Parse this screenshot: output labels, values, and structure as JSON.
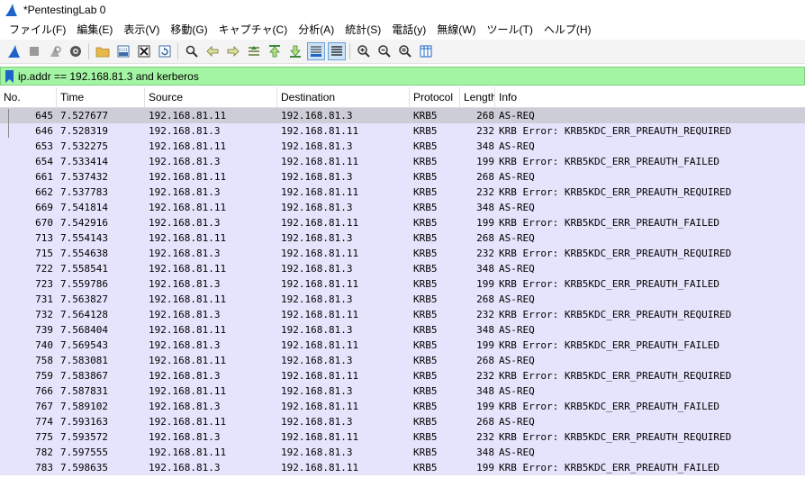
{
  "window": {
    "title": "*PentestingLab 0"
  },
  "menu": [
    "ファイル(F)",
    "編集(E)",
    "表示(V)",
    "移動(G)",
    "キャプチャ(C)",
    "分析(A)",
    "統計(S)",
    "電話(y)",
    "無線(W)",
    "ツール(T)",
    "ヘルプ(H)"
  ],
  "toolbar_icons": [
    "shark-fin-start-icon",
    "stop-icon",
    "restart-icon",
    "capture-options-icon",
    "|",
    "open-file-icon",
    "save-file-icon",
    "close-file-icon",
    "reload-file-icon",
    "|",
    "find-packet-icon",
    "go-back-icon",
    "go-forward-icon",
    "go-to-packet-icon",
    "go-first-icon",
    "go-last-icon",
    "autoscroll-icon",
    "colorize-icon",
    "|",
    "zoom-in-icon",
    "zoom-out-icon",
    "zoom-normal-icon",
    "resize-columns-icon"
  ],
  "filter": {
    "value": "ip.addr == 192.168.81.3 and kerberos"
  },
  "columns": [
    "No.",
    "Time",
    "Source",
    "Destination",
    "Protocol",
    "Length",
    "Info"
  ],
  "rows": [
    {
      "no": "645",
      "time": "7.527677",
      "src": "192.168.81.11",
      "dst": "192.168.81.3",
      "proto": "KRB5",
      "len": "268",
      "info": "AS-REQ"
    },
    {
      "no": "646",
      "time": "7.528319",
      "src": "192.168.81.3",
      "dst": "192.168.81.11",
      "proto": "KRB5",
      "len": "232",
      "info": "KRB Error: KRB5KDC_ERR_PREAUTH_REQUIRED"
    },
    {
      "no": "653",
      "time": "7.532275",
      "src": "192.168.81.11",
      "dst": "192.168.81.3",
      "proto": "KRB5",
      "len": "348",
      "info": "AS-REQ"
    },
    {
      "no": "654",
      "time": "7.533414",
      "src": "192.168.81.3",
      "dst": "192.168.81.11",
      "proto": "KRB5",
      "len": "199",
      "info": "KRB Error: KRB5KDC_ERR_PREAUTH_FAILED"
    },
    {
      "no": "661",
      "time": "7.537432",
      "src": "192.168.81.11",
      "dst": "192.168.81.3",
      "proto": "KRB5",
      "len": "268",
      "info": "AS-REQ"
    },
    {
      "no": "662",
      "time": "7.537783",
      "src": "192.168.81.3",
      "dst": "192.168.81.11",
      "proto": "KRB5",
      "len": "232",
      "info": "KRB Error: KRB5KDC_ERR_PREAUTH_REQUIRED"
    },
    {
      "no": "669",
      "time": "7.541814",
      "src": "192.168.81.11",
      "dst": "192.168.81.3",
      "proto": "KRB5",
      "len": "348",
      "info": "AS-REQ"
    },
    {
      "no": "670",
      "time": "7.542916",
      "src": "192.168.81.3",
      "dst": "192.168.81.11",
      "proto": "KRB5",
      "len": "199",
      "info": "KRB Error: KRB5KDC_ERR_PREAUTH_FAILED"
    },
    {
      "no": "713",
      "time": "7.554143",
      "src": "192.168.81.11",
      "dst": "192.168.81.3",
      "proto": "KRB5",
      "len": "268",
      "info": "AS-REQ"
    },
    {
      "no": "715",
      "time": "7.554638",
      "src": "192.168.81.3",
      "dst": "192.168.81.11",
      "proto": "KRB5",
      "len": "232",
      "info": "KRB Error: KRB5KDC_ERR_PREAUTH_REQUIRED"
    },
    {
      "no": "722",
      "time": "7.558541",
      "src": "192.168.81.11",
      "dst": "192.168.81.3",
      "proto": "KRB5",
      "len": "348",
      "info": "AS-REQ"
    },
    {
      "no": "723",
      "time": "7.559786",
      "src": "192.168.81.3",
      "dst": "192.168.81.11",
      "proto": "KRB5",
      "len": "199",
      "info": "KRB Error: KRB5KDC_ERR_PREAUTH_FAILED"
    },
    {
      "no": "731",
      "time": "7.563827",
      "src": "192.168.81.11",
      "dst": "192.168.81.3",
      "proto": "KRB5",
      "len": "268",
      "info": "AS-REQ"
    },
    {
      "no": "732",
      "time": "7.564128",
      "src": "192.168.81.3",
      "dst": "192.168.81.11",
      "proto": "KRB5",
      "len": "232",
      "info": "KRB Error: KRB5KDC_ERR_PREAUTH_REQUIRED"
    },
    {
      "no": "739",
      "time": "7.568404",
      "src": "192.168.81.11",
      "dst": "192.168.81.3",
      "proto": "KRB5",
      "len": "348",
      "info": "AS-REQ"
    },
    {
      "no": "740",
      "time": "7.569543",
      "src": "192.168.81.3",
      "dst": "192.168.81.11",
      "proto": "KRB5",
      "len": "199",
      "info": "KRB Error: KRB5KDC_ERR_PREAUTH_FAILED"
    },
    {
      "no": "758",
      "time": "7.583081",
      "src": "192.168.81.11",
      "dst": "192.168.81.3",
      "proto": "KRB5",
      "len": "268",
      "info": "AS-REQ"
    },
    {
      "no": "759",
      "time": "7.583867",
      "src": "192.168.81.3",
      "dst": "192.168.81.11",
      "proto": "KRB5",
      "len": "232",
      "info": "KRB Error: KRB5KDC_ERR_PREAUTH_REQUIRED"
    },
    {
      "no": "766",
      "time": "7.587831",
      "src": "192.168.81.11",
      "dst": "192.168.81.3",
      "proto": "KRB5",
      "len": "348",
      "info": "AS-REQ"
    },
    {
      "no": "767",
      "time": "7.589102",
      "src": "192.168.81.3",
      "dst": "192.168.81.11",
      "proto": "KRB5",
      "len": "199",
      "info": "KRB Error: KRB5KDC_ERR_PREAUTH_FAILED"
    },
    {
      "no": "774",
      "time": "7.593163",
      "src": "192.168.81.11",
      "dst": "192.168.81.3",
      "proto": "KRB5",
      "len": "268",
      "info": "AS-REQ"
    },
    {
      "no": "775",
      "time": "7.593572",
      "src": "192.168.81.3",
      "dst": "192.168.81.11",
      "proto": "KRB5",
      "len": "232",
      "info": "KRB Error: KRB5KDC_ERR_PREAUTH_REQUIRED"
    },
    {
      "no": "782",
      "time": "7.597555",
      "src": "192.168.81.11",
      "dst": "192.168.81.3",
      "proto": "KRB5",
      "len": "348",
      "info": "AS-REQ"
    },
    {
      "no": "783",
      "time": "7.598635",
      "src": "192.168.81.3",
      "dst": "192.168.81.11",
      "proto": "KRB5",
      "len": "199",
      "info": "KRB Error: KRB5KDC_ERR_PREAUTH_FAILED"
    }
  ],
  "selected_row": 0,
  "colors": {
    "row_bg": "#e6e4fc",
    "selected_bg": "#cdcdd8",
    "filter_ok_bg": "#a3f5a3",
    "accent": "#1e64c8"
  }
}
